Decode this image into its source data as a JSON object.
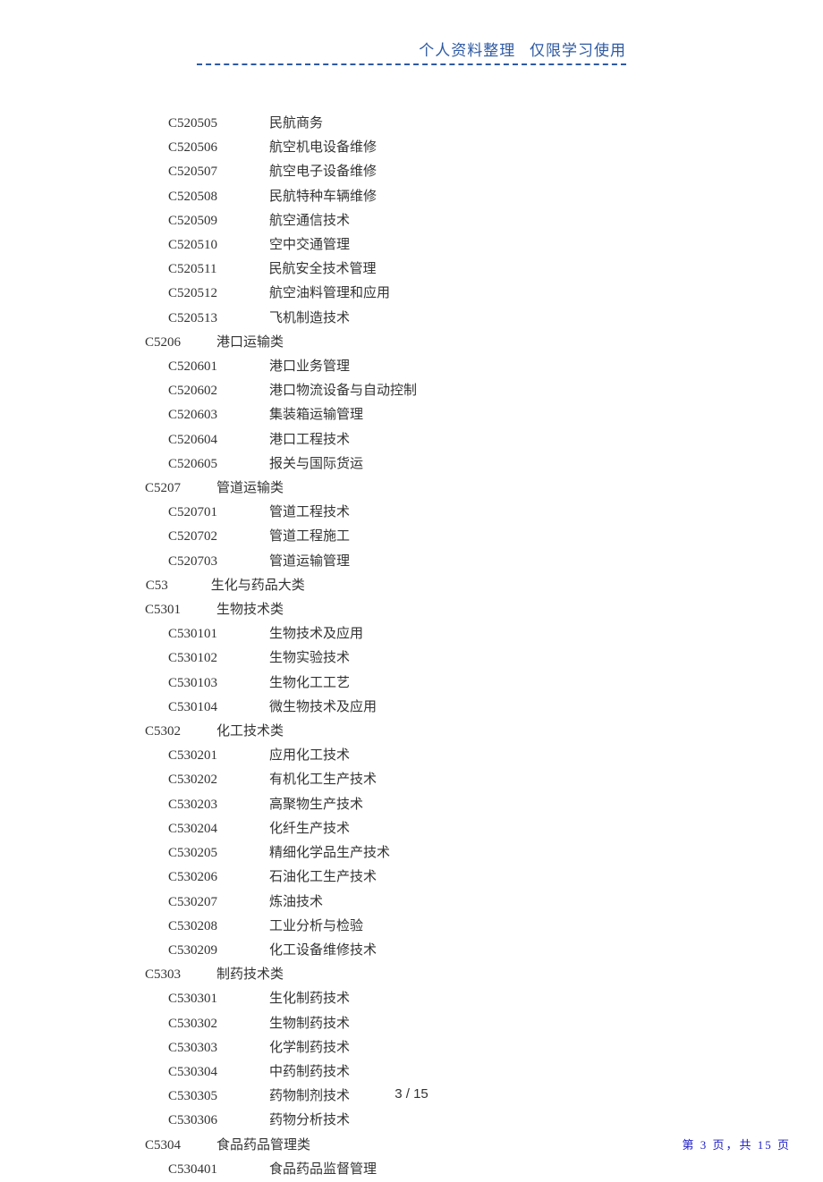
{
  "header": {
    "left": "个人资料整理",
    "right": "仅限学习使用"
  },
  "rows": [
    {
      "t": "item",
      "code": "C520505",
      "name": "民航商务"
    },
    {
      "t": "item",
      "code": "C520506",
      "name": "航空机电设备维修"
    },
    {
      "t": "item",
      "code": "C520507",
      "name": "航空电子设备维修"
    },
    {
      "t": "item",
      "code": "C520508",
      "name": "民航特种车辆维修"
    },
    {
      "t": "item",
      "code": "C520509",
      "name": "航空通信技术"
    },
    {
      "t": "item",
      "code": "C520510",
      "name": "空中交通管理"
    },
    {
      "t": "item",
      "code": "C520511",
      "name": "民航安全技术管理"
    },
    {
      "t": "item",
      "code": "C520512",
      "name": "航空油料管理和应用"
    },
    {
      "t": "item",
      "code": "C520513",
      "name": "飞机制造技术"
    },
    {
      "t": "cat",
      "code": "C5206",
      "name": "港口运输类"
    },
    {
      "t": "item",
      "code": "C520601",
      "name": "港口业务管理"
    },
    {
      "t": "item",
      "code": "C520602",
      "name": "港口物流设备与自动控制"
    },
    {
      "t": "item",
      "code": "C520603",
      "name": "集装箱运输管理"
    },
    {
      "t": "item",
      "code": "C520604",
      "name": "港口工程技术"
    },
    {
      "t": "item",
      "code": "C520605",
      "name": "报关与国际货运"
    },
    {
      "t": "cat",
      "code": "C5207",
      "name": "管道运输类"
    },
    {
      "t": "item",
      "code": "C520701",
      "name": "管道工程技术"
    },
    {
      "t": "item",
      "code": "C520702",
      "name": "管道工程施工"
    },
    {
      "t": "item",
      "code": "C520703",
      "name": "管道运输管理"
    },
    {
      "t": "big",
      "code": "C53",
      "name": "生化与药品大类"
    },
    {
      "t": "cat",
      "code": "C5301",
      "name": "生物技术类"
    },
    {
      "t": "item",
      "code": "C530101",
      "name": "生物技术及应用"
    },
    {
      "t": "item",
      "code": "C530102",
      "name": "生物实验技术"
    },
    {
      "t": "item",
      "code": "C530103",
      "name": "生物化工工艺"
    },
    {
      "t": "item",
      "code": "C530104",
      "name": "微生物技术及应用"
    },
    {
      "t": "cat",
      "code": "C5302",
      "name": "化工技术类"
    },
    {
      "t": "item",
      "code": "C530201",
      "name": "应用化工技术"
    },
    {
      "t": "item",
      "code": "C530202",
      "name": "有机化工生产技术"
    },
    {
      "t": "item",
      "code": "C530203",
      "name": "高聚物生产技术"
    },
    {
      "t": "item",
      "code": "C530204",
      "name": "化纤生产技术"
    },
    {
      "t": "item",
      "code": "C530205",
      "name": "精细化学品生产技术"
    },
    {
      "t": "item",
      "code": "C530206",
      "name": "石油化工生产技术"
    },
    {
      "t": "item",
      "code": "C530207",
      "name": "炼油技术"
    },
    {
      "t": "item",
      "code": "C530208",
      "name": "工业分析与检验"
    },
    {
      "t": "item",
      "code": "C530209",
      "name": "化工设备维修技术"
    },
    {
      "t": "cat",
      "code": "C5303",
      "name": "制药技术类"
    },
    {
      "t": "item",
      "code": "C530301",
      "name": "生化制药技术"
    },
    {
      "t": "item",
      "code": "C530302",
      "name": "生物制药技术"
    },
    {
      "t": "item",
      "code": "C530303",
      "name": "化学制药技术"
    },
    {
      "t": "item",
      "code": "C530304",
      "name": "中药制药技术"
    },
    {
      "t": "item",
      "code": "C530305",
      "name": "药物制剂技术"
    },
    {
      "t": "item",
      "code": "C530306",
      "name": "药物分析技术"
    },
    {
      "t": "cat",
      "code": "C5304",
      "name": "食品药品管理类"
    },
    {
      "t": "item",
      "code": "C530401",
      "name": "食品药品监督管理"
    }
  ],
  "footer": {
    "center": "3 / 15",
    "right": "第 3 页，共 15 页"
  }
}
